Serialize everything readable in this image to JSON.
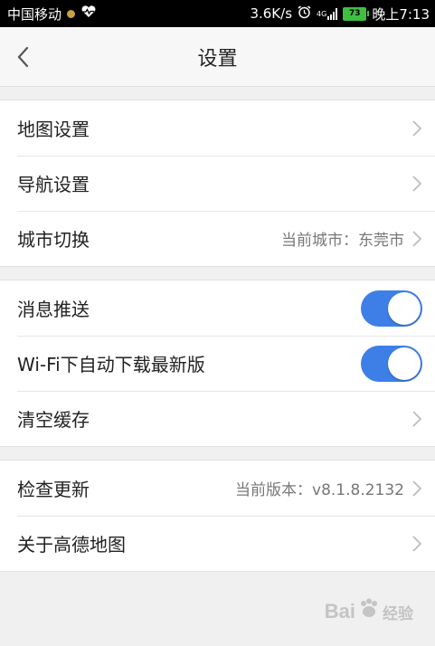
{
  "status_bar": {
    "carrier": "中国移动",
    "speed": "3.6K/s",
    "network": "4G",
    "battery": "73",
    "time": "晚上7:13"
  },
  "header": {
    "title": "设置"
  },
  "groups": [
    {
      "rows": [
        {
          "label": "地图设置"
        },
        {
          "label": "导航设置"
        },
        {
          "label": "城市切换",
          "value": "当前城市：东莞市"
        }
      ]
    },
    {
      "rows": [
        {
          "label": "消息推送",
          "toggle": true
        },
        {
          "label": "Wi-Fi下自动下载最新版",
          "toggle": true
        },
        {
          "label": "清空缓存"
        }
      ]
    },
    {
      "rows": [
        {
          "label": "检查更新",
          "value": "当前版本：v8.1.8.2132"
        },
        {
          "label": "关于高德地图"
        }
      ]
    }
  ],
  "watermark": {
    "text": "Bai",
    "suffix": "经验"
  },
  "colors": {
    "accent": "#3d7fe6",
    "background": "#f0f0f0"
  }
}
